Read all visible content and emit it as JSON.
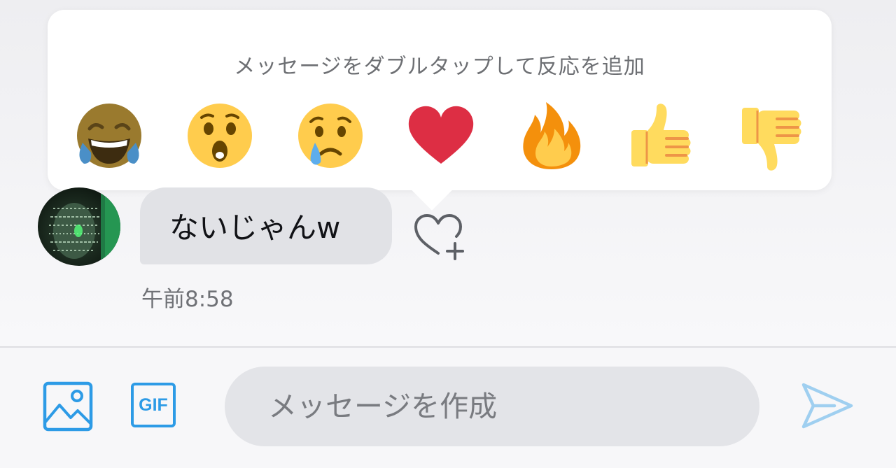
{
  "reaction_picker": {
    "hint": "メッセージをダブルタップして反応を追加",
    "reactions": [
      {
        "icon": "tears-of-joy-emoji",
        "emoji": "😂"
      },
      {
        "icon": "surprised-emoji",
        "emoji": "😲"
      },
      {
        "icon": "crying-emoji",
        "emoji": "😢"
      },
      {
        "icon": "red-heart-emoji",
        "emoji": "❤️"
      },
      {
        "icon": "fire-emoji",
        "emoji": "🔥"
      },
      {
        "icon": "thumbs-up-emoji",
        "emoji": "👍"
      },
      {
        "icon": "thumbs-down-emoji",
        "emoji": "👎"
      }
    ]
  },
  "message": {
    "text": "ないじゃんw",
    "time": "午前8:58",
    "add_reaction_icon": "heart-plus-icon"
  },
  "composer": {
    "media_icon": "image-icon",
    "gif_label": "GIF",
    "placeholder": "メッセージを作成",
    "value": "",
    "send_icon": "send-icon"
  },
  "colors": {
    "accent": "#2d9be6",
    "bubble": "#e1e2e6",
    "input": "#e3e4e8",
    "heart": "#dd2e44",
    "emoji_yellow": "#ffcc4d"
  }
}
